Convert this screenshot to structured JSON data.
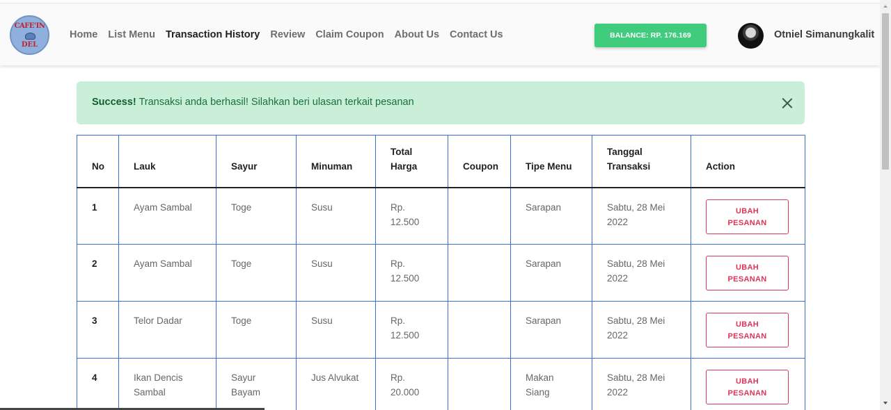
{
  "logo": {
    "top_text": "CAFE'IN",
    "bottom_text": "DEL"
  },
  "nav": {
    "items": [
      {
        "label": "Home",
        "active": false
      },
      {
        "label": "List Menu",
        "active": false
      },
      {
        "label": "Transaction History",
        "active": true
      },
      {
        "label": "Review",
        "active": false
      },
      {
        "label": "Claim Coupon",
        "active": false
      },
      {
        "label": "About Us",
        "active": false
      },
      {
        "label": "Contact Us",
        "active": false
      }
    ]
  },
  "balance": {
    "label": "BALANCE: RP. 176.169",
    "color": "#3fcc7d"
  },
  "user": {
    "name": "Otniel Simanungkalit"
  },
  "alert": {
    "strong": "Success!",
    "message": " Transaksi anda berhasil! Silahkan beri ulasan terkait pesanan"
  },
  "table": {
    "headers": {
      "no": "No",
      "lauk": "Lauk",
      "sayur": "Sayur",
      "minuman": "Minuman",
      "total_1": "Total",
      "total_2": "Harga",
      "coupon": "Coupon",
      "tipe": "Tipe Menu",
      "tanggal_1": "Tanggal",
      "tanggal_2": "Transaksi",
      "action": "Action"
    },
    "rows": [
      {
        "no": "1",
        "lauk_1": "Ayam Sambal",
        "lauk_2": "",
        "sayur_1": "Toge",
        "sayur_2": "",
        "minuman": "Susu",
        "harga_1": "Rp.",
        "harga_2": "12.500",
        "coupon": "",
        "tipe_1": "Sarapan",
        "tipe_2": "",
        "tanggal_1": "Sabtu, 28 Mei",
        "tanggal_2": "2022",
        "btn_1": "UBAH",
        "btn_2": "PESANAN"
      },
      {
        "no": "2",
        "lauk_1": "Ayam Sambal",
        "lauk_2": "",
        "sayur_1": "Toge",
        "sayur_2": "",
        "minuman": "Susu",
        "harga_1": "Rp.",
        "harga_2": "12.500",
        "coupon": "",
        "tipe_1": "Sarapan",
        "tipe_2": "",
        "tanggal_1": "Sabtu, 28 Mei",
        "tanggal_2": "2022",
        "btn_1": "UBAH",
        "btn_2": "PESANAN"
      },
      {
        "no": "3",
        "lauk_1": "Telor Dadar",
        "lauk_2": "",
        "sayur_1": "Toge",
        "sayur_2": "",
        "minuman": "Susu",
        "harga_1": "Rp.",
        "harga_2": "12.500",
        "coupon": "",
        "tipe_1": "Sarapan",
        "tipe_2": "",
        "tanggal_1": "Sabtu, 28 Mei",
        "tanggal_2": "2022",
        "btn_1": "UBAH",
        "btn_2": "PESANAN"
      },
      {
        "no": "4",
        "lauk_1": "Ikan Dencis",
        "lauk_2": "Sambal",
        "sayur_1": "Sayur",
        "sayur_2": "Bayam",
        "minuman": "Jus Alvukat",
        "harga_1": "Rp.",
        "harga_2": "20.000",
        "coupon": "",
        "tipe_1": "Makan",
        "tipe_2": "Siang",
        "tanggal_1": "Sabtu, 28 Mei",
        "tanggal_2": "2022",
        "btn_1": "UBAH",
        "btn_2": "PESANAN"
      }
    ]
  }
}
